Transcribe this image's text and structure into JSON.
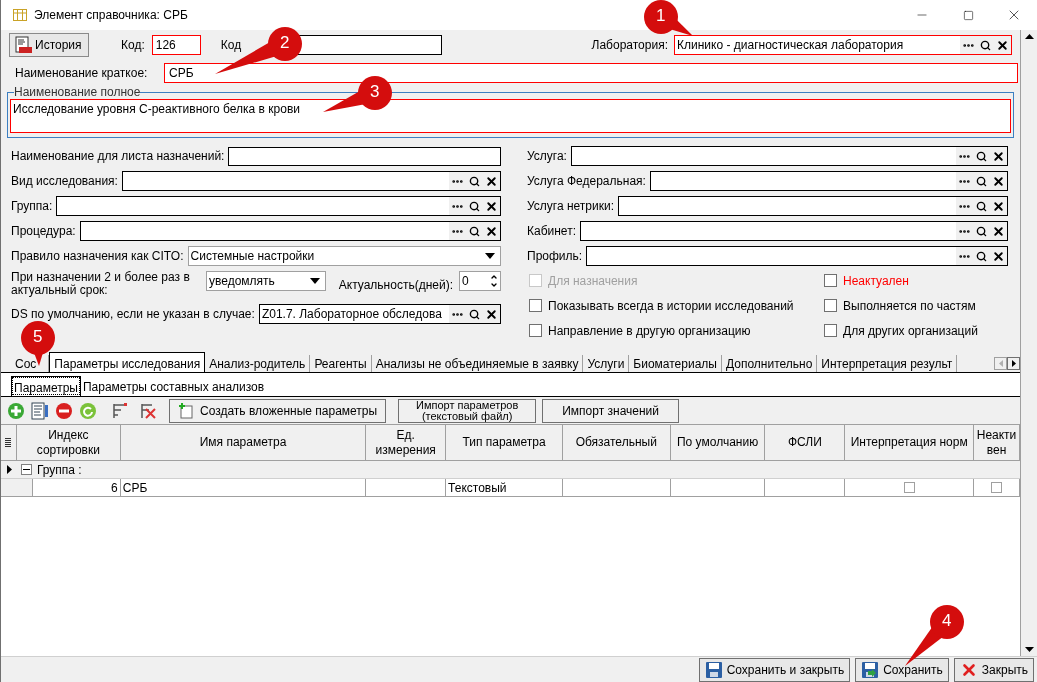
{
  "window": {
    "title": "Элемент справочника: СРБ"
  },
  "header": {
    "history_button": "История",
    "code_label": "Код:",
    "code_value": "126",
    "code_required": true,
    "code2_label": "Код",
    "code2_required": false,
    "laboratory_label": "Лаборатория:",
    "laboratory_value": "Клинико - диагностическая лаборатория",
    "laboratory_required": true
  },
  "short_name": {
    "label": "Наименование краткое:",
    "value": "СРБ",
    "required": true
  },
  "full_name": {
    "label": "Наименование полное",
    "value": "Исследование уровня С-реактивного белка в крови",
    "required": true
  },
  "left_fields": [
    {
      "kind": "text",
      "label": "Наименование для листа назначений:"
    },
    {
      "kind": "lookup",
      "label": "Вид исследования:"
    },
    {
      "kind": "lookup",
      "label": "Группа:"
    },
    {
      "kind": "lookup",
      "label": "Процедура:"
    },
    {
      "kind": "select",
      "label": "Правило назначения как CITO:",
      "value": "Системные настройки"
    },
    {
      "kind": "select_spin",
      "label": "При назначении 2 и более раз в актуальный срок:",
      "value": "уведомлять",
      "spin_label": "Актуальность(дней):",
      "spin_value": "0"
    },
    {
      "kind": "lookup",
      "label": "DS по умолчанию, если не указан в случае:",
      "value": "Z01.7. Лабораторное обследова"
    }
  ],
  "right_fields": [
    {
      "kind": "lookup",
      "label": "Услуга:"
    },
    {
      "kind": "lookup",
      "label": "Услуга Федеральная:"
    },
    {
      "kind": "lookup",
      "label": "Услуга нетрики:"
    },
    {
      "kind": "lookup",
      "label": "Кабинет:"
    },
    {
      "kind": "lookup",
      "label": "Профиль:"
    }
  ],
  "checkboxes": [
    {
      "label": "Для назначения",
      "checked": false,
      "disabled": true,
      "alert": false
    },
    {
      "label": "Неактуален",
      "checked": false,
      "disabled": false,
      "alert": true
    },
    {
      "label": "Показывать всегда в истории исследований",
      "checked": false,
      "disabled": false,
      "alert": false
    },
    {
      "label": "Выполняется по частям",
      "checked": false,
      "disabled": false,
      "alert": false
    },
    {
      "label": "Направление в другую организацию",
      "checked": false,
      "disabled": false,
      "alert": false
    },
    {
      "label": "Для других организаций",
      "checked": false,
      "disabled": false,
      "alert": false
    }
  ],
  "tabs": [
    {
      "label": "Сос",
      "selected": false
    },
    {
      "label": "Параметры исследования",
      "selected": true
    },
    {
      "label": "Анализ-родитель",
      "selected": false
    },
    {
      "label": "Реагенты",
      "selected": false
    },
    {
      "label": "Анализы не объединяемые в заявку",
      "selected": false
    },
    {
      "label": "Услуги",
      "selected": false
    },
    {
      "label": "Биоматериалы",
      "selected": false
    },
    {
      "label": "Дополнительно",
      "selected": false
    },
    {
      "label": "Интерпретация результ",
      "selected": false
    }
  ],
  "subtabs": [
    {
      "label": "Параметры",
      "selected": true
    },
    {
      "label": "Параметры составных анализов",
      "selected": false
    }
  ],
  "toolbar": {
    "create_nested": "Создать вложенные параметры",
    "import_params": "Импорт параметров (текстовый файл)",
    "import_values": "Импорт значений"
  },
  "table": {
    "columns": [
      "Индекс сортировки",
      "Имя параметра",
      "Ед. измерения",
      "Тип параметра",
      "Обязательный",
      "По умолчанию",
      "ФСЛИ",
      "Интерпретация норм",
      "Неактивен"
    ],
    "groups": [
      {
        "label": "Группа :",
        "expanded": true,
        "rows": [
          {
            "cells": [
              {
                "kind": "number",
                "text": "6"
              },
              {
                "kind": "text",
                "text": "СРБ"
              },
              {
                "kind": "text"
              },
              {
                "kind": "text",
                "text": "Текстовый"
              },
              {
                "kind": "text"
              },
              {
                "kind": "text"
              },
              {
                "kind": "text"
              },
              {
                "kind": "check",
                "checked": false
              },
              {
                "kind": "check",
                "checked": false
              }
            ]
          }
        ]
      }
    ]
  },
  "footer_buttons": [
    {
      "kind": "save_close",
      "label": "Сохранить и закрыть"
    },
    {
      "kind": "save",
      "label": "Сохранить"
    },
    {
      "kind": "close",
      "label": "Закрыть"
    }
  ],
  "callouts": [
    {
      "number": "1"
    },
    {
      "number": "2"
    },
    {
      "number": "3"
    },
    {
      "number": "4"
    },
    {
      "number": "5"
    }
  ]
}
